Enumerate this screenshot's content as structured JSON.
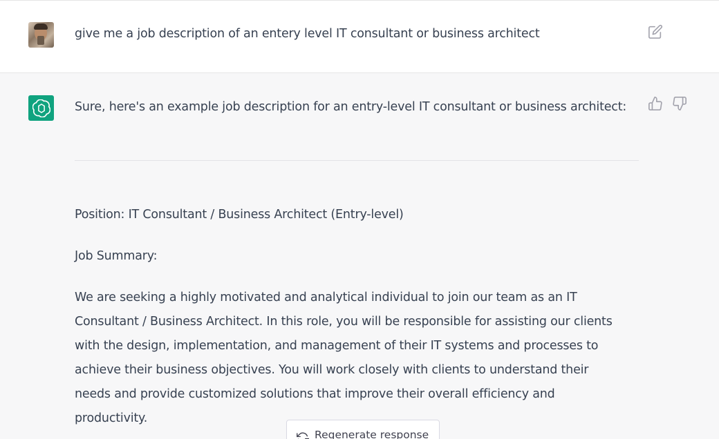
{
  "user_message": {
    "text": "give me a job description of an entery level IT consultant or business architect"
  },
  "assistant_message": {
    "intro": "Sure, here's an example job description for an entry-level IT consultant or business architect:",
    "position": "Position: IT Consultant / Business Architect (Entry-level)",
    "summary_label": "Job Summary:",
    "paragraph_lines": [
      "We are seeking a highly motivated and analytical individual to join our team as an IT",
      "Consultant / Business Architect. In this role, you will be responsible for assisting our clients",
      "with the design, implementation, and management of their IT systems and processes to",
      "achieve their business objectives. You will work closely with clients to understand their",
      "needs and provide customized solutions that improve their overall efficiency and",
      "productivity."
    ]
  },
  "controls": {
    "regenerate_label": "Regenerate response"
  },
  "icons": {
    "edit": "edit-icon",
    "thumb_up": "thumbs-up-icon",
    "thumb_down": "thumbs-down-icon",
    "assistant_logo": "openai-logo-icon",
    "regenerate": "refresh-icon"
  },
  "colors": {
    "assistant_bg": "#f7f7f8",
    "user_bg": "#ffffff",
    "brand": "#10a37f",
    "text": "#374151"
  }
}
